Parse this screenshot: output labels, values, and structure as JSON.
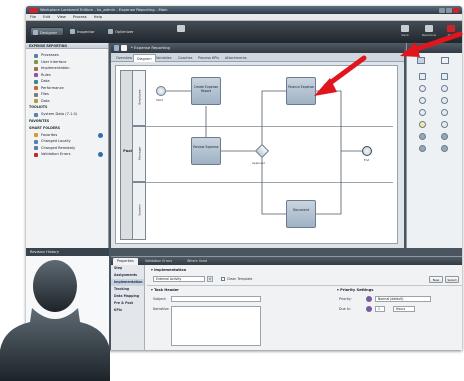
{
  "window": {
    "title": "Workplace Lombardi Edition - ko_admin - Expense Reporting - Main",
    "accent": "#c9262b"
  },
  "menu": [
    "File",
    "Edit",
    "View",
    "Process",
    "Help"
  ],
  "perspectives": [
    {
      "label": "Designer",
      "active": true
    },
    {
      "label": "Inspector",
      "active": false
    },
    {
      "label": "Optimizer",
      "active": false
    }
  ],
  "toolbar": {
    "items": [
      "Save",
      "Revisions",
      "Help"
    ]
  },
  "library": {
    "header": "EXPENSE REPORTING",
    "items": [
      {
        "label": "Processes",
        "icon": "process-icon",
        "color": "#5b7fa8"
      },
      {
        "label": "User Interface",
        "icon": "ui-icon",
        "color": "#7a9a4b"
      },
      {
        "label": "Implementation",
        "icon": "implementation-icon",
        "color": "#a0743c"
      },
      {
        "label": "Rules",
        "icon": "rules-icon",
        "color": "#8a5aa0"
      },
      {
        "label": "Data",
        "icon": "data-icon",
        "color": "#3d8a8a"
      },
      {
        "label": "Performance",
        "icon": "performance-icon",
        "color": "#c46a2e"
      },
      {
        "label": "Files",
        "icon": "files-icon",
        "color": "#7c7c7c"
      },
      {
        "label": "Data",
        "icon": "data-icon",
        "color": "#b09a3c"
      }
    ],
    "toolkits_header": "TOOLKITS",
    "toolkits": [
      {
        "label": "System Data (7.1.0)",
        "count": ""
      }
    ],
    "favorites_header": "FAVORITES",
    "smart_folders_header": "SMART FOLDERS",
    "smart_folders": [
      {
        "label": "Favorites",
        "count": "0",
        "color": "#d89a2a"
      },
      {
        "label": "Changed Locally",
        "count": "",
        "color": "#5b7fa8"
      },
      {
        "label": "Changed Remotely",
        "count": "",
        "color": "#5b7fa8"
      },
      {
        "label": "Validation Errors",
        "count": "0",
        "color": "#c9262b"
      }
    ],
    "revision_bar": "Revision History"
  },
  "editor": {
    "title": "* Expense Reporting",
    "tabs": [
      "Overview",
      "Diagram",
      "Variables",
      "Coaches",
      "Process KPIs",
      "Attachments"
    ],
    "active_tab": "Diagram",
    "pool": "Pool",
    "lanes": [
      "Employee",
      "Manager",
      "System"
    ],
    "nodes": {
      "start": "Start",
      "create": "Create Expense Report",
      "review": "Review Expense",
      "approve": "Approve?",
      "finance": "Finance Expense",
      "end": "End",
      "system_task": "Document"
    }
  },
  "properties": {
    "tabs": [
      "Properties",
      "Validation Errors",
      "Where Used"
    ],
    "active_tab": "Properties",
    "nav": [
      "Step",
      "Assignments",
      "Implementation",
      "Tracking",
      "Data Mapping",
      "Pre & Post",
      "KPIs"
    ],
    "selected_nav": "Implementation",
    "implementation_header": "Implementation",
    "impl_select": "External Activity",
    "impl_checkbox": "Clean Template",
    "new_button": "New",
    "select_button": "Select",
    "task_header_header": "Task Header",
    "subject_label": "Subject:",
    "subject_value": "",
    "narrative_label": "Narrative:",
    "priority_header": "Priority Settings",
    "priority_label": "Priority:",
    "priority_value": "Normal (default)",
    "due_label": "Due In:",
    "due_value": "1",
    "due_unit": "Hours"
  }
}
